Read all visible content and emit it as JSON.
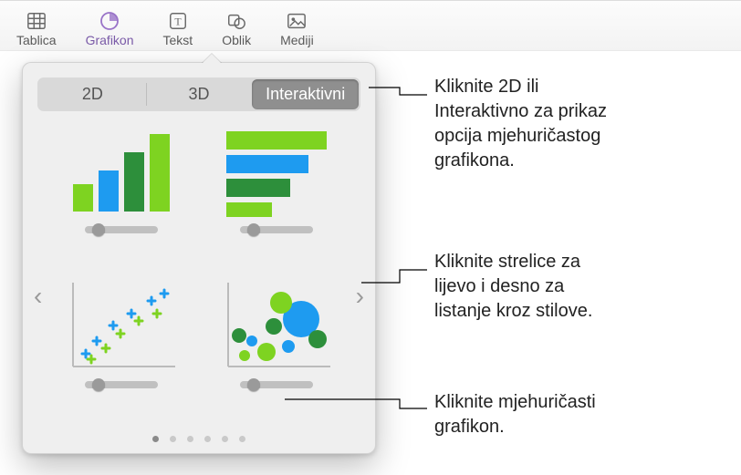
{
  "toolbar": {
    "items": [
      {
        "label": "Tablica",
        "icon": "table-icon"
      },
      {
        "label": "Grafikon",
        "icon": "chart-pie-icon",
        "active": true
      },
      {
        "label": "Tekst",
        "icon": "text-icon"
      },
      {
        "label": "Oblik",
        "icon": "shape-icon"
      },
      {
        "label": "Mediji",
        "icon": "media-icon"
      }
    ]
  },
  "segmented": {
    "items": [
      "2D",
      "3D",
      "Interaktivni"
    ],
    "selected": 2
  },
  "chart_tiles": [
    {
      "name": "interactive-column-chart"
    },
    {
      "name": "interactive-bar-chart"
    },
    {
      "name": "interactive-scatter-chart"
    },
    {
      "name": "interactive-bubble-chart"
    }
  ],
  "pagination": {
    "count": 6,
    "active": 0
  },
  "callouts": {
    "c1": "Kliknite 2D ili\nInteraktivno za prikaz\nopcija mjehuričastog\ngrafikona.",
    "c2": "Kliknite strelice za\nlijevo i desno za\nlistanje kroz stilove.",
    "c3": "Kliknite mjehuričasti\ngrafikon."
  },
  "colors": {
    "green": "#7ED321",
    "blue": "#1E9BF0",
    "darkgreen": "#2D8F3B"
  }
}
